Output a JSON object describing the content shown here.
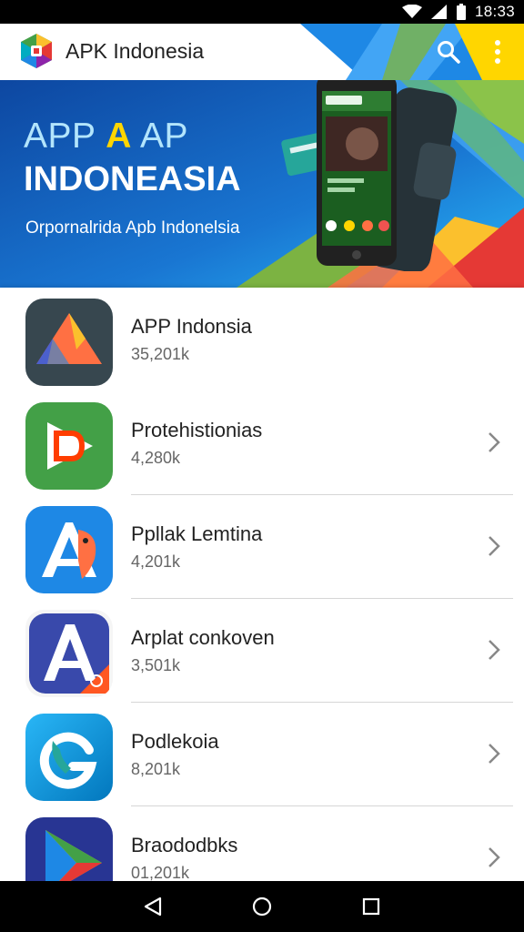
{
  "status_bar": {
    "time": "18:33"
  },
  "app_bar": {
    "title": "APK Indonesia"
  },
  "banner": {
    "line1_part1": "APP",
    "line1_accent": "A",
    "line1_part2": "AP",
    "line2": "INDONEASIA",
    "subtitle": "Orpornalrida Apb Indonelsia"
  },
  "apps": [
    {
      "name": "APP Indonsia",
      "size": "35,201k",
      "icon": "triangle-logo-icon",
      "has_chevron": false
    },
    {
      "name": "Protehistionias",
      "size": "4,280k",
      "icon": "play-d-icon",
      "has_chevron": true
    },
    {
      "name": "Ppllak Lemtina",
      "size": "4,201k",
      "icon": "letter-a-bird-icon",
      "has_chevron": true
    },
    {
      "name": "Arplat conkoven",
      "size": "3,501k",
      "icon": "letter-a-badge-icon",
      "has_chevron": true
    },
    {
      "name": "Podlekoia",
      "size": "8,201k",
      "icon": "phone-g-icon",
      "has_chevron": true
    },
    {
      "name": "Braododbks",
      "size": "01,201k",
      "icon": "play-store-icon",
      "has_chevron": true
    }
  ],
  "colors": {
    "banner_blue": "#1565d8",
    "accent_yellow": "#ffd600",
    "accent_green": "#8bc34a",
    "accent_red": "#e53935"
  }
}
